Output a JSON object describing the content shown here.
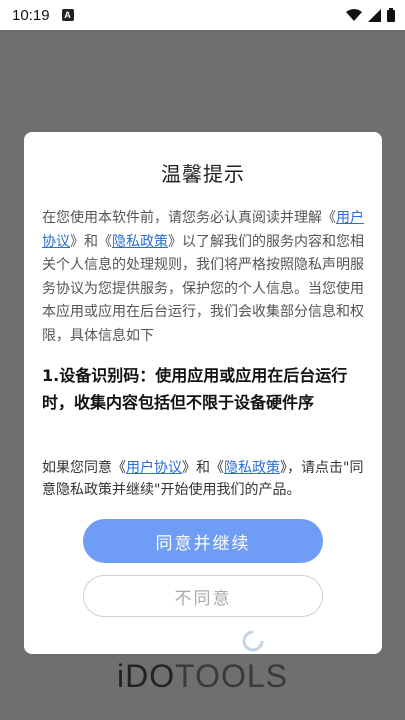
{
  "status_bar": {
    "time": "10:19",
    "notification_icon": "A"
  },
  "dialog": {
    "title": "温馨提示",
    "intro": {
      "pre": "在您使用本软件前，请您务必认真阅读并理解《",
      "link1": "用户协议",
      "mid": "》和《",
      "link2": "隐私政策",
      "post": "》以了解我们的服务内容和您相关个人信息的处理规则，我们将严格按照隐私声明服务协议为您提供服务，保护您的个人信息。当您使用本应用或应用在后台运行，我们会收集部分信息和权限，具体信息如下"
    },
    "section_heading": "1.设备识别码：使用应用或应用在后台运行时，收集内容包括但不限于设备硬件序",
    "consent": {
      "pre": "如果您同意《",
      "link1": "用户协议",
      "mid": "》和《",
      "link2": "隐私政策",
      "post": "》，请点击\"同意隐私政策并继续\"开始使用我们的产品。"
    },
    "agree_label": "同意并继续",
    "disagree_label": "不同意"
  },
  "background_logo": {
    "part1": "iDO",
    "part2": "TOOLS"
  },
  "colors": {
    "primary": "#6f9cf5",
    "link": "#2b6fd6",
    "overlay": "#6f6f6f"
  }
}
